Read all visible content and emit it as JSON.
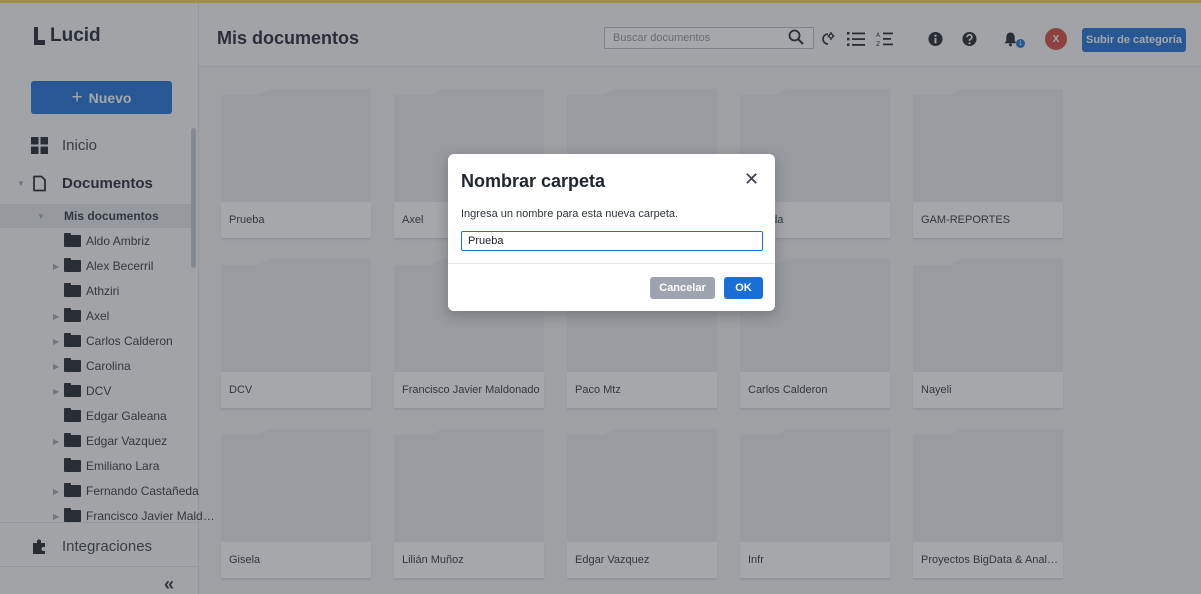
{
  "app": {
    "logo_text": "Lucid"
  },
  "sidebar": {
    "new_button": "Nuevo",
    "nav": {
      "home": "Inicio",
      "documents": "Documentos",
      "integrations": "Integraciones"
    },
    "tree": [
      {
        "label": "Mis documentos",
        "expandable": true,
        "active": true
      },
      {
        "label": "Aldo Ambriz",
        "expandable": false
      },
      {
        "label": "Alex Becerril",
        "expandable": true
      },
      {
        "label": "Athziri",
        "expandable": false
      },
      {
        "label": "Axel",
        "expandable": true
      },
      {
        "label": "Carlos Calderon",
        "expandable": true
      },
      {
        "label": "Carolina",
        "expandable": true
      },
      {
        "label": "DCV",
        "expandable": true
      },
      {
        "label": "Edgar Galeana",
        "expandable": false
      },
      {
        "label": "Edgar Vazquez",
        "expandable": true
      },
      {
        "label": "Emiliano Lara",
        "expandable": false
      },
      {
        "label": "Fernando Castañeda",
        "expandable": true
      },
      {
        "label": "Francisco Javier Mald…",
        "expandable": true
      }
    ],
    "collapse_glyph": "«"
  },
  "header": {
    "title": "Mis documentos",
    "search_placeholder": "Buscar documentos",
    "avatar_initial": "X",
    "notification_count": "1",
    "upload_button": "Subir de categoría"
  },
  "folders": [
    "Prueba",
    "Axel",
    "",
    "Aranda",
    "GAM-REPORTES",
    "DCV",
    "Francisco Javier Maldonado",
    "Paco Mtz",
    "Carlos Calderon",
    "Nayeli",
    "Gisela",
    "Lilián Muñoz",
    "Edgar Vazquez",
    "Infr",
    "Proyectos BigData & Anal…"
  ],
  "modal": {
    "title": "Nombrar carpeta",
    "description": "Ingresa un nombre para esta nueva carpeta.",
    "input_value": "Prueba",
    "cancel": "Cancelar",
    "ok": "OK"
  },
  "colors": {
    "accent": "#1a6fd6",
    "avatar": "#d4463f",
    "top_line": "#f4d54a"
  }
}
